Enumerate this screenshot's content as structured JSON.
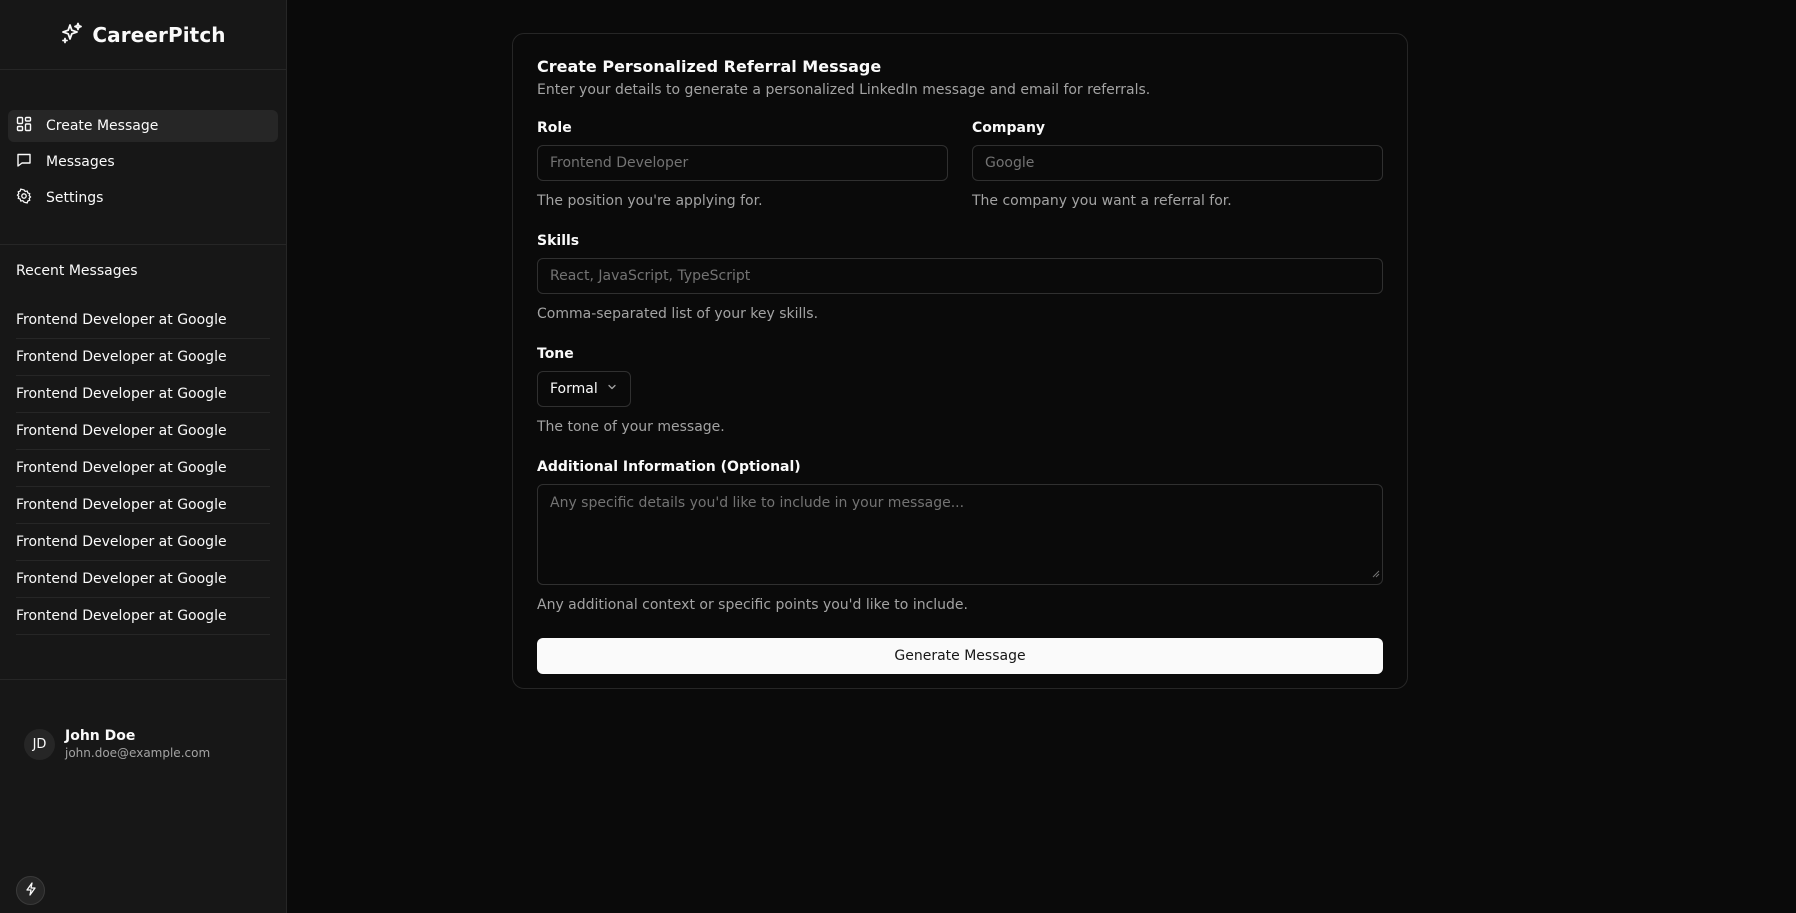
{
  "app": {
    "name": "CareerPitch"
  },
  "nav": {
    "items": [
      {
        "label": "Create Message",
        "icon": "dashboard-icon",
        "active": true
      },
      {
        "label": "Messages",
        "icon": "message-square-icon",
        "active": false
      },
      {
        "label": "Settings",
        "icon": "gear-icon",
        "active": false
      }
    ]
  },
  "recent": {
    "title": "Recent Messages",
    "items": [
      "Frontend Developer at Google",
      "Frontend Developer at Google",
      "Frontend Developer at Google",
      "Frontend Developer at Google",
      "Frontend Developer at Google",
      "Frontend Developer at Google",
      "Frontend Developer at Google",
      "Frontend Developer at Google",
      "Frontend Developer at Google"
    ]
  },
  "user": {
    "initials": "JD",
    "name": "John Doe",
    "email": "john.doe@example.com"
  },
  "form": {
    "title": "Create Personalized Referral Message",
    "description": "Enter your details to generate a personalized LinkedIn message and email for referrals.",
    "role": {
      "label": "Role",
      "placeholder": "Frontend Developer",
      "value": "",
      "hint": "The position you're applying for."
    },
    "company": {
      "label": "Company",
      "placeholder": "Google",
      "value": "",
      "hint": "The company you want a referral for."
    },
    "skills": {
      "label": "Skills",
      "placeholder": "React, JavaScript, TypeScript",
      "value": "",
      "hint": "Comma-separated list of your key skills."
    },
    "tone": {
      "label": "Tone",
      "selected": "Formal",
      "hint": "The tone of your message."
    },
    "additional": {
      "label": "Additional Information (Optional)",
      "placeholder": "Any specific details you'd like to include in your message...",
      "value": "",
      "hint": "Any additional context or specific points you'd like to include."
    },
    "submit_label": "Generate Message"
  },
  "colors": {
    "background": "#0a0a0a",
    "sidebar": "#171717",
    "border": "#262626",
    "primary_button": "#fafafa"
  }
}
